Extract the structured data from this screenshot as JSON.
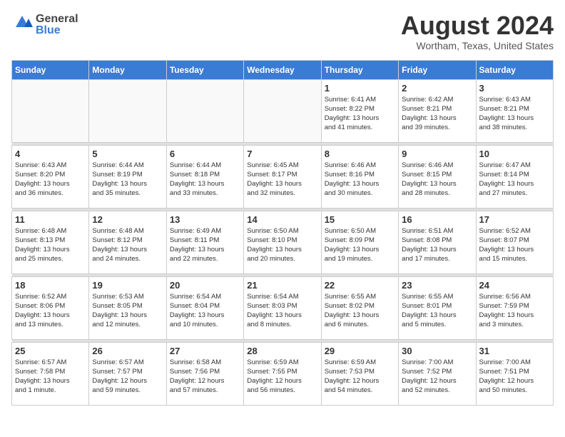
{
  "header": {
    "logo_general": "General",
    "logo_blue": "Blue",
    "month": "August 2024",
    "location": "Wortham, Texas, United States"
  },
  "days_of_week": [
    "Sunday",
    "Monday",
    "Tuesday",
    "Wednesday",
    "Thursday",
    "Friday",
    "Saturday"
  ],
  "weeks": [
    [
      {
        "day": "",
        "info": ""
      },
      {
        "day": "",
        "info": ""
      },
      {
        "day": "",
        "info": ""
      },
      {
        "day": "",
        "info": ""
      },
      {
        "day": "1",
        "info": "Sunrise: 6:41 AM\nSunset: 8:22 PM\nDaylight: 13 hours\nand 41 minutes."
      },
      {
        "day": "2",
        "info": "Sunrise: 6:42 AM\nSunset: 8:21 PM\nDaylight: 13 hours\nand 39 minutes."
      },
      {
        "day": "3",
        "info": "Sunrise: 6:43 AM\nSunset: 8:21 PM\nDaylight: 13 hours\nand 38 minutes."
      }
    ],
    [
      {
        "day": "4",
        "info": "Sunrise: 6:43 AM\nSunset: 8:20 PM\nDaylight: 13 hours\nand 36 minutes."
      },
      {
        "day": "5",
        "info": "Sunrise: 6:44 AM\nSunset: 8:19 PM\nDaylight: 13 hours\nand 35 minutes."
      },
      {
        "day": "6",
        "info": "Sunrise: 6:44 AM\nSunset: 8:18 PM\nDaylight: 13 hours\nand 33 minutes."
      },
      {
        "day": "7",
        "info": "Sunrise: 6:45 AM\nSunset: 8:17 PM\nDaylight: 13 hours\nand 32 minutes."
      },
      {
        "day": "8",
        "info": "Sunrise: 6:46 AM\nSunset: 8:16 PM\nDaylight: 13 hours\nand 30 minutes."
      },
      {
        "day": "9",
        "info": "Sunrise: 6:46 AM\nSunset: 8:15 PM\nDaylight: 13 hours\nand 28 minutes."
      },
      {
        "day": "10",
        "info": "Sunrise: 6:47 AM\nSunset: 8:14 PM\nDaylight: 13 hours\nand 27 minutes."
      }
    ],
    [
      {
        "day": "11",
        "info": "Sunrise: 6:48 AM\nSunset: 8:13 PM\nDaylight: 13 hours\nand 25 minutes."
      },
      {
        "day": "12",
        "info": "Sunrise: 6:48 AM\nSunset: 8:12 PM\nDaylight: 13 hours\nand 24 minutes."
      },
      {
        "day": "13",
        "info": "Sunrise: 6:49 AM\nSunset: 8:11 PM\nDaylight: 13 hours\nand 22 minutes."
      },
      {
        "day": "14",
        "info": "Sunrise: 6:50 AM\nSunset: 8:10 PM\nDaylight: 13 hours\nand 20 minutes."
      },
      {
        "day": "15",
        "info": "Sunrise: 6:50 AM\nSunset: 8:09 PM\nDaylight: 13 hours\nand 19 minutes."
      },
      {
        "day": "16",
        "info": "Sunrise: 6:51 AM\nSunset: 8:08 PM\nDaylight: 13 hours\nand 17 minutes."
      },
      {
        "day": "17",
        "info": "Sunrise: 6:52 AM\nSunset: 8:07 PM\nDaylight: 13 hours\nand 15 minutes."
      }
    ],
    [
      {
        "day": "18",
        "info": "Sunrise: 6:52 AM\nSunset: 8:06 PM\nDaylight: 13 hours\nand 13 minutes."
      },
      {
        "day": "19",
        "info": "Sunrise: 6:53 AM\nSunset: 8:05 PM\nDaylight: 13 hours\nand 12 minutes."
      },
      {
        "day": "20",
        "info": "Sunrise: 6:54 AM\nSunset: 8:04 PM\nDaylight: 13 hours\nand 10 minutes."
      },
      {
        "day": "21",
        "info": "Sunrise: 6:54 AM\nSunset: 8:03 PM\nDaylight: 13 hours\nand 8 minutes."
      },
      {
        "day": "22",
        "info": "Sunrise: 6:55 AM\nSunset: 8:02 PM\nDaylight: 13 hours\nand 6 minutes."
      },
      {
        "day": "23",
        "info": "Sunrise: 6:55 AM\nSunset: 8:01 PM\nDaylight: 13 hours\nand 5 minutes."
      },
      {
        "day": "24",
        "info": "Sunrise: 6:56 AM\nSunset: 7:59 PM\nDaylight: 13 hours\nand 3 minutes."
      }
    ],
    [
      {
        "day": "25",
        "info": "Sunrise: 6:57 AM\nSunset: 7:58 PM\nDaylight: 13 hours\nand 1 minute."
      },
      {
        "day": "26",
        "info": "Sunrise: 6:57 AM\nSunset: 7:57 PM\nDaylight: 12 hours\nand 59 minutes."
      },
      {
        "day": "27",
        "info": "Sunrise: 6:58 AM\nSunset: 7:56 PM\nDaylight: 12 hours\nand 57 minutes."
      },
      {
        "day": "28",
        "info": "Sunrise: 6:59 AM\nSunset: 7:55 PM\nDaylight: 12 hours\nand 56 minutes."
      },
      {
        "day": "29",
        "info": "Sunrise: 6:59 AM\nSunset: 7:53 PM\nDaylight: 12 hours\nand 54 minutes."
      },
      {
        "day": "30",
        "info": "Sunrise: 7:00 AM\nSunset: 7:52 PM\nDaylight: 12 hours\nand 52 minutes."
      },
      {
        "day": "31",
        "info": "Sunrise: 7:00 AM\nSunset: 7:51 PM\nDaylight: 12 hours\nand 50 minutes."
      }
    ]
  ]
}
